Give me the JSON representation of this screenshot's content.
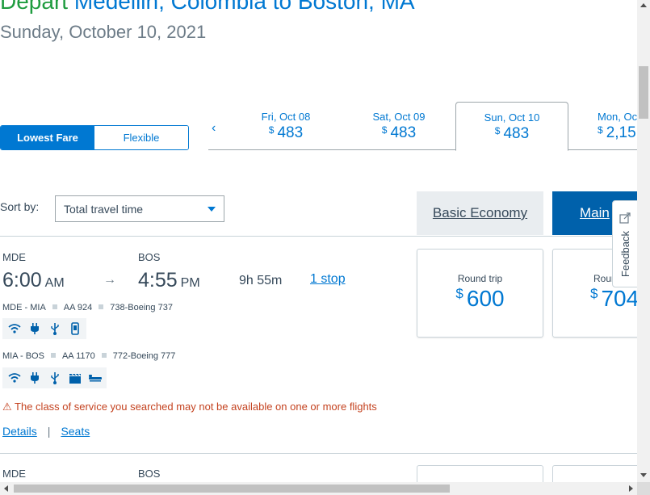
{
  "header": {
    "depart_word": "Depart",
    "route": "Medellin, Colombia to Boston, MA",
    "date": "Sunday, October 10, 2021"
  },
  "toggle": {
    "lowest_fare": "Lowest Fare",
    "flexible": "Flexible"
  },
  "date_strip": {
    "prev": "‹",
    "currency": "$",
    "dates": [
      {
        "label": "Fri, Oct 08",
        "price": "483"
      },
      {
        "label": "Sat, Oct 09",
        "price": "483"
      },
      {
        "label": "Sun, Oct 10",
        "price": "483"
      },
      {
        "label": "Mon, Oc",
        "price": "2,15"
      }
    ]
  },
  "sort": {
    "label": "Sort by:",
    "value": "Total travel time"
  },
  "cabins": {
    "basic": "Basic Economy",
    "main": "Main"
  },
  "flight1": {
    "origin": "MDE",
    "destination": "BOS",
    "depart_time": "6:00",
    "depart_ampm": "AM",
    "arrive_time": "4:55",
    "arrive_ampm": "PM",
    "arrow": "→",
    "duration": "9h  55m",
    "stops": "1 stop",
    "segments": [
      {
        "route": "MDE - MIA",
        "flight": "AA 924",
        "aircraft": "738-Boeing 737"
      },
      {
        "route": "MIA - BOS",
        "flight": "AA 1170",
        "aircraft": "772-Boeing 777"
      }
    ],
    "warning_icon": "⚠",
    "warning": "The class of service you searched may not be available on one or more flights",
    "details": "Details",
    "sep": "|",
    "seats": "Seats",
    "fares": [
      {
        "type": "Round trip",
        "currency": "$",
        "price": "600"
      },
      {
        "type": "Roun",
        "currency": "$",
        "price": "704"
      }
    ]
  },
  "flight2": {
    "origin": "MDE",
    "destination": "BOS"
  },
  "feedback": {
    "label": "Feedback"
  },
  "colors": {
    "accent": "#0078d2",
    "depart_green": "#1f9c3f",
    "main_cabin": "#0061ab",
    "warning": "#c4421f"
  }
}
